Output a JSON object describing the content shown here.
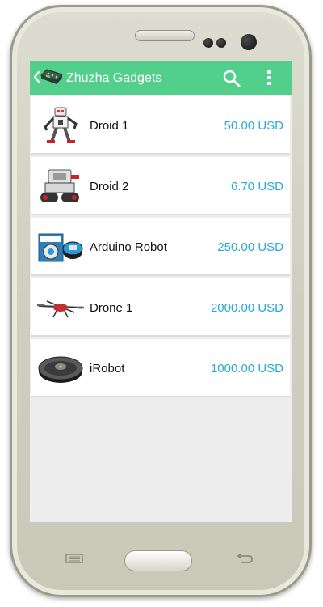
{
  "app": {
    "title": "Zhuzha Gadgets",
    "accent_color": "#52cf8a",
    "price_color": "#2aa8d6",
    "icons": {
      "back": "chevron-left-icon",
      "logo": "circuit-board-logo-icon",
      "search": "search-icon",
      "overflow": "overflow-menu-icon"
    }
  },
  "products": [
    {
      "name": "Droid 1",
      "price": "50.00 USD",
      "thumb": "white-humanoid-robot"
    },
    {
      "name": "Droid 2",
      "price": "6.70 USD",
      "thumb": "tracked-robot-kit"
    },
    {
      "name": "Arduino Robot",
      "price": "250.00 USD",
      "thumb": "arduino-robot-box"
    },
    {
      "name": "Drone 1",
      "price": "2000.00 USD",
      "thumb": "quadcopter-drone"
    },
    {
      "name": "iRobot",
      "price": "1000.00 USD",
      "thumb": "robot-vacuum"
    }
  ],
  "hardware_buttons": [
    "menu-button",
    "home-button",
    "back-button"
  ]
}
